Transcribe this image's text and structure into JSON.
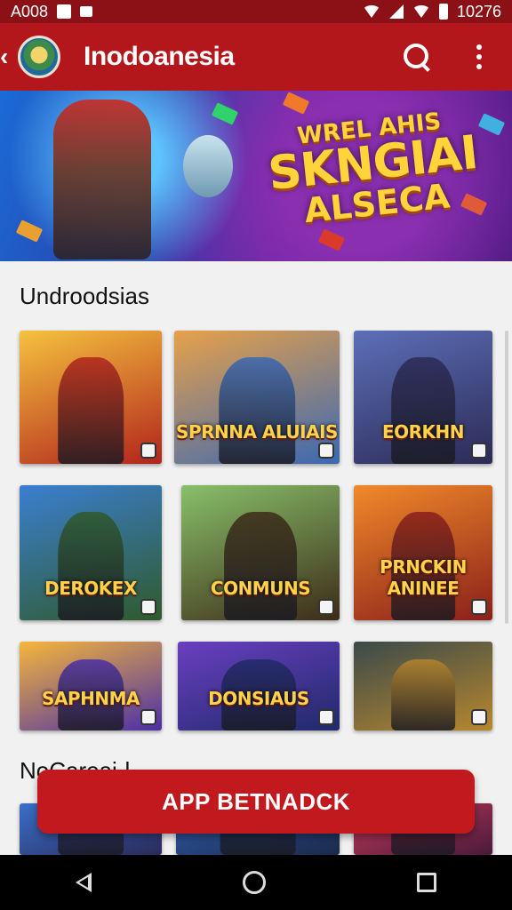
{
  "status_bar": {
    "time_left": "A008",
    "time_right": "10276"
  },
  "app_bar": {
    "title": "Inodoanesia"
  },
  "banner": {
    "line1": "WREL AHIS",
    "line2": "SKNGIAI",
    "line3": "ALSECA"
  },
  "section1": {
    "title": "Undroodsias",
    "games": [
      {
        "label": "",
        "colors": [
          "#f5c23e",
          "#b1241c"
        ]
      },
      {
        "label": "SPRNNA ALUIAIS",
        "colors": [
          "#e7a14a",
          "#3a68b4"
        ]
      },
      {
        "label": "EORKHN",
        "colors": [
          "#5d6fb8",
          "#2b2a55"
        ]
      },
      {
        "label": "DEROKEX",
        "colors": [
          "#3b7fd1",
          "#2f5a2a"
        ]
      },
      {
        "label": "CONMUNS",
        "colors": [
          "#88c06a",
          "#3d2b18"
        ]
      },
      {
        "label": "PRNCKIN ANINEE",
        "colors": [
          "#f08a2a",
          "#8a1f1a"
        ]
      },
      {
        "label": "SAPHNMA",
        "colors": [
          "#f6b63a",
          "#4a2fa8"
        ]
      },
      {
        "label": "DONSIAUS",
        "colors": [
          "#6a3fc0",
          "#1f2a6a"
        ]
      },
      {
        "label": "",
        "colors": [
          "#3a4a4a",
          "#b8872e"
        ]
      }
    ]
  },
  "section2": {
    "title": "NoCareai-l",
    "games": [
      {
        "colors": [
          "#3a6fc8",
          "#2a2a5a"
        ]
      },
      {
        "colors": [
          "#2f5aa8",
          "#1a2a4a"
        ]
      },
      {
        "colors": [
          "#c23a5a",
          "#4a1a3a"
        ]
      }
    ]
  },
  "cta": {
    "label": "APP BETNADCK"
  },
  "theme": {
    "primary": "#b3171c",
    "status": "#8b1117",
    "accent": "#ffd43b"
  }
}
